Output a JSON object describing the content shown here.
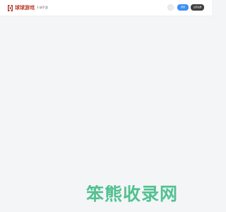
{
  "header": {
    "logo": {
      "icon": "logo-mark-icon",
      "text": "球球游戏"
    },
    "nav": {
      "link_text": "3 球手游"
    },
    "user": {
      "avatar_icon": "avatar-icon"
    },
    "buttons": {
      "login_label": "登录",
      "register_label": "立即注册"
    }
  },
  "watermark": {
    "text": "笨熊收录网"
  },
  "colors": {
    "background": "#f4f5f7",
    "header_bg": "#ffffff",
    "brand_red": "#c0392b",
    "login_blue": "#3d8ff5",
    "register_dark": "#3f3f3f",
    "watermark_green": "#46be8a"
  }
}
